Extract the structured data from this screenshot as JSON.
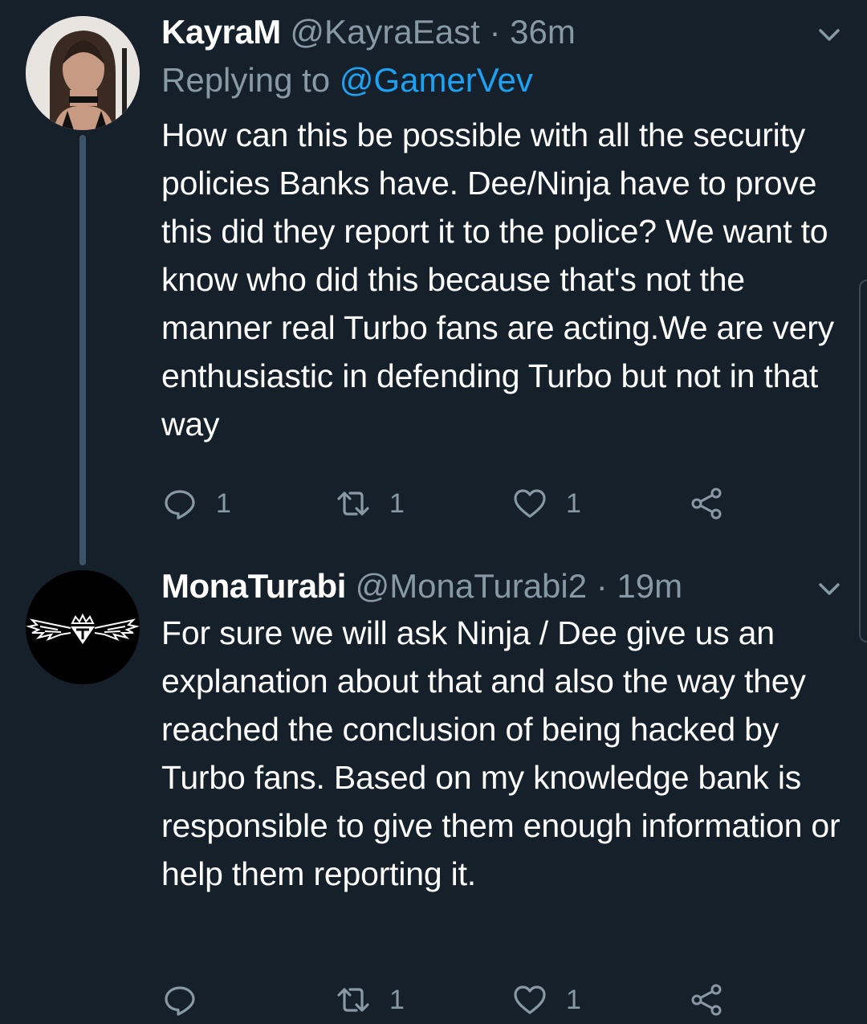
{
  "tweets": [
    {
      "display_name": "KayraM",
      "handle": "@KayraEast",
      "separator": "·",
      "time": "36m",
      "replying_prefix": "Replying to",
      "replying_to": "@GamerVev",
      "text": "How can this be possible with all the security policies Banks have. Dee/Ninja have to prove this did they report it to the police? We want to know who did this because that's not the manner real Turbo fans are acting.We are very enthusiastic in defending Turbo but not in that way",
      "reply_count": "1",
      "retweet_count": "1",
      "like_count": "1"
    },
    {
      "display_name": "MonaTurabi",
      "handle": "@MonaTurabi2",
      "separator": "·",
      "time": "19m",
      "text": "For sure we will ask Ninja / Dee give us an explanation about that and also the way they reached the conclusion of being hacked by Turbo fans. Based on my knowledge bank is responsible to give them enough information or help them reporting it.",
      "reply_count": "",
      "retweet_count": "1",
      "like_count": "1"
    }
  ],
  "icons": {
    "reply": "reply-icon",
    "retweet": "retweet-icon",
    "like": "heart-icon",
    "share": "share-icon",
    "more": "chevron-down-icon"
  },
  "colors": {
    "background": "#15202b",
    "text": "#ffffff",
    "secondary": "#8899a6",
    "link": "#1da1f2",
    "thread_line": "#3d5466"
  }
}
